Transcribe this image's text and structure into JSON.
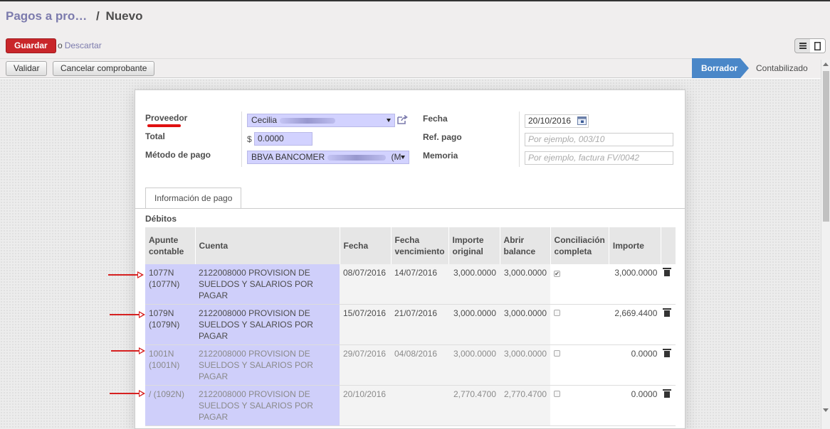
{
  "breadcrumb": {
    "parent": "Pagos a pro…",
    "separator": "/",
    "current": "Nuevo"
  },
  "actions": {
    "save_label": "Guardar",
    "or_label": "o",
    "discard_label": "Descartar"
  },
  "toolbar": {
    "validate_label": "Validar",
    "cancel_label": "Cancelar comprobante"
  },
  "status": {
    "active": "Borrador",
    "next": "Contabilizado"
  },
  "form": {
    "proveedor_label": "Proveedor",
    "proveedor_value": "Cecilia",
    "total_label": "Total",
    "currency_symbol": "$",
    "total_value": "0.0000",
    "metodo_label": "Método de pago",
    "metodo_value": "BBVA BANCOMER",
    "metodo_suffix": "(M",
    "fecha_label": "Fecha",
    "fecha_value": "20/10/2016",
    "ref_label": "Ref. pago",
    "ref_placeholder": "Por ejemplo, 003/10",
    "memoria_label": "Memoria",
    "memoria_placeholder": "Por ejemplo, factura FV/0042"
  },
  "tabs": [
    {
      "label": "Información de pago"
    }
  ],
  "debitos": {
    "title": "Débitos",
    "columns": [
      "Apunte contable",
      "Cuenta",
      "Fecha",
      "Fecha vencimiento",
      "Importe original",
      "Abrir balance",
      "Conciliación completa",
      "Importe"
    ],
    "rows": [
      {
        "apunte": "1077N (1077N)",
        "cuenta": "2122008000 PROVISION DE SUELDOS Y SALARIOS POR PAGAR",
        "fecha": "08/07/2016",
        "vencimiento": "14/07/2016",
        "original": "3,000.0000",
        "balance": "3,000.0000",
        "conciliado": true,
        "importe": "3,000.0000"
      },
      {
        "apunte": "1079N (1079N)",
        "cuenta": "2122008000 PROVISION DE SUELDOS Y SALARIOS POR PAGAR",
        "fecha": "15/07/2016",
        "vencimiento": "21/07/2016",
        "original": "3,000.0000",
        "balance": "3,000.0000",
        "conciliado": false,
        "importe": "2,669.4400"
      },
      {
        "apunte": "1001N (1001N)",
        "cuenta": "2122008000 PROVISION DE SUELDOS Y SALARIOS POR PAGAR",
        "fecha": "29/07/2016",
        "vencimiento": "04/08/2016",
        "original": "3,000.0000",
        "balance": "3,000.0000",
        "conciliado": false,
        "importe": "0.0000"
      },
      {
        "apunte": "/ (1092N)",
        "cuenta": "2122008000 PROVISION DE SUELDOS Y SALARIOS POR PAGAR",
        "fecha": "20/10/2016",
        "vencimiento": "",
        "original": "2,770.4700",
        "balance": "2,770.4700",
        "conciliado": false,
        "importe": "0.0000"
      }
    ]
  },
  "colors": {
    "accent": "#7c7bad",
    "save": "#c9262a",
    "status_active": "#4a87c8",
    "required_field": "#d2d2ff",
    "annotation": "#d62020"
  }
}
